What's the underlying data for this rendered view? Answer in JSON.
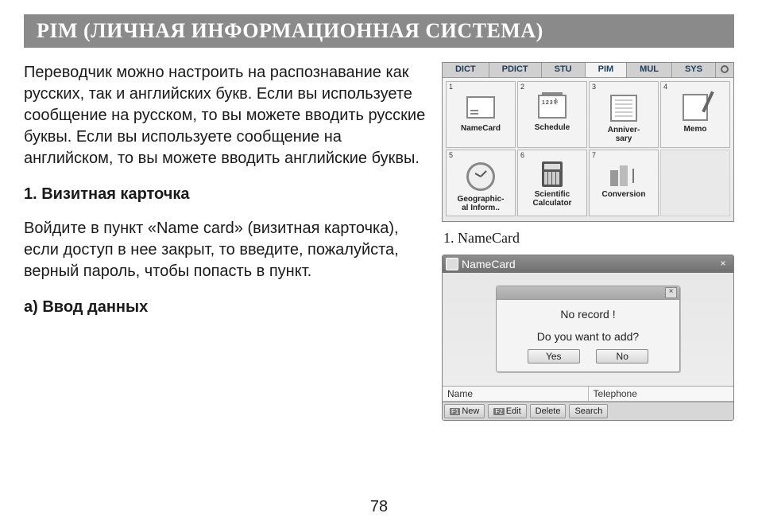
{
  "title": "PIM (ЛИЧНАЯ ИНФОРМАЦИОННАЯ СИСТЕМА)",
  "left": {
    "para1": "Переводчик можно настроить на распознавание как русских, так и английских букв. Если вы используете сообщение на русском, то вы можете вводить русские буквы. Если вы используете сообщение на английском, то вы можете вводить английские буквы.",
    "section1": "1. Визитная карточка",
    "para2": "Войдите в пункт «Name card» (визитная карточка), если доступ в нее закрыт, то введите, пожалуйста, верный пароль, чтобы попасть в пункт.",
    "section2": "a) Ввод данных"
  },
  "pim": {
    "tabs": [
      "DICT",
      "PDICT",
      "STU",
      "PIM",
      "MUL",
      "SYS"
    ],
    "active_tab": 3,
    "items": [
      {
        "num": "1",
        "label": "NameCard"
      },
      {
        "num": "2",
        "label": "Schedule"
      },
      {
        "num": "3",
        "label": "Anniver-\nsary"
      },
      {
        "num": "4",
        "label": "Memo"
      },
      {
        "num": "5",
        "label": "Geographic-\nal Inform.."
      },
      {
        "num": "6",
        "label": "Scientific\nCalculator"
      },
      {
        "num": "7",
        "label": "Conversion"
      }
    ],
    "hint": "1. NameCard"
  },
  "namecard": {
    "title": "NameCard",
    "dialog": {
      "line1": "No record !",
      "line2": "Do you want to add?",
      "yes": "Yes",
      "no": "No"
    },
    "columns": {
      "name": "Name",
      "tel": "Telephone"
    },
    "footer": {
      "new": "New",
      "edit": "Edit",
      "delete": "Delete",
      "search": "Search",
      "f1": "F1",
      "f2": "F2"
    }
  },
  "page_number": "78"
}
